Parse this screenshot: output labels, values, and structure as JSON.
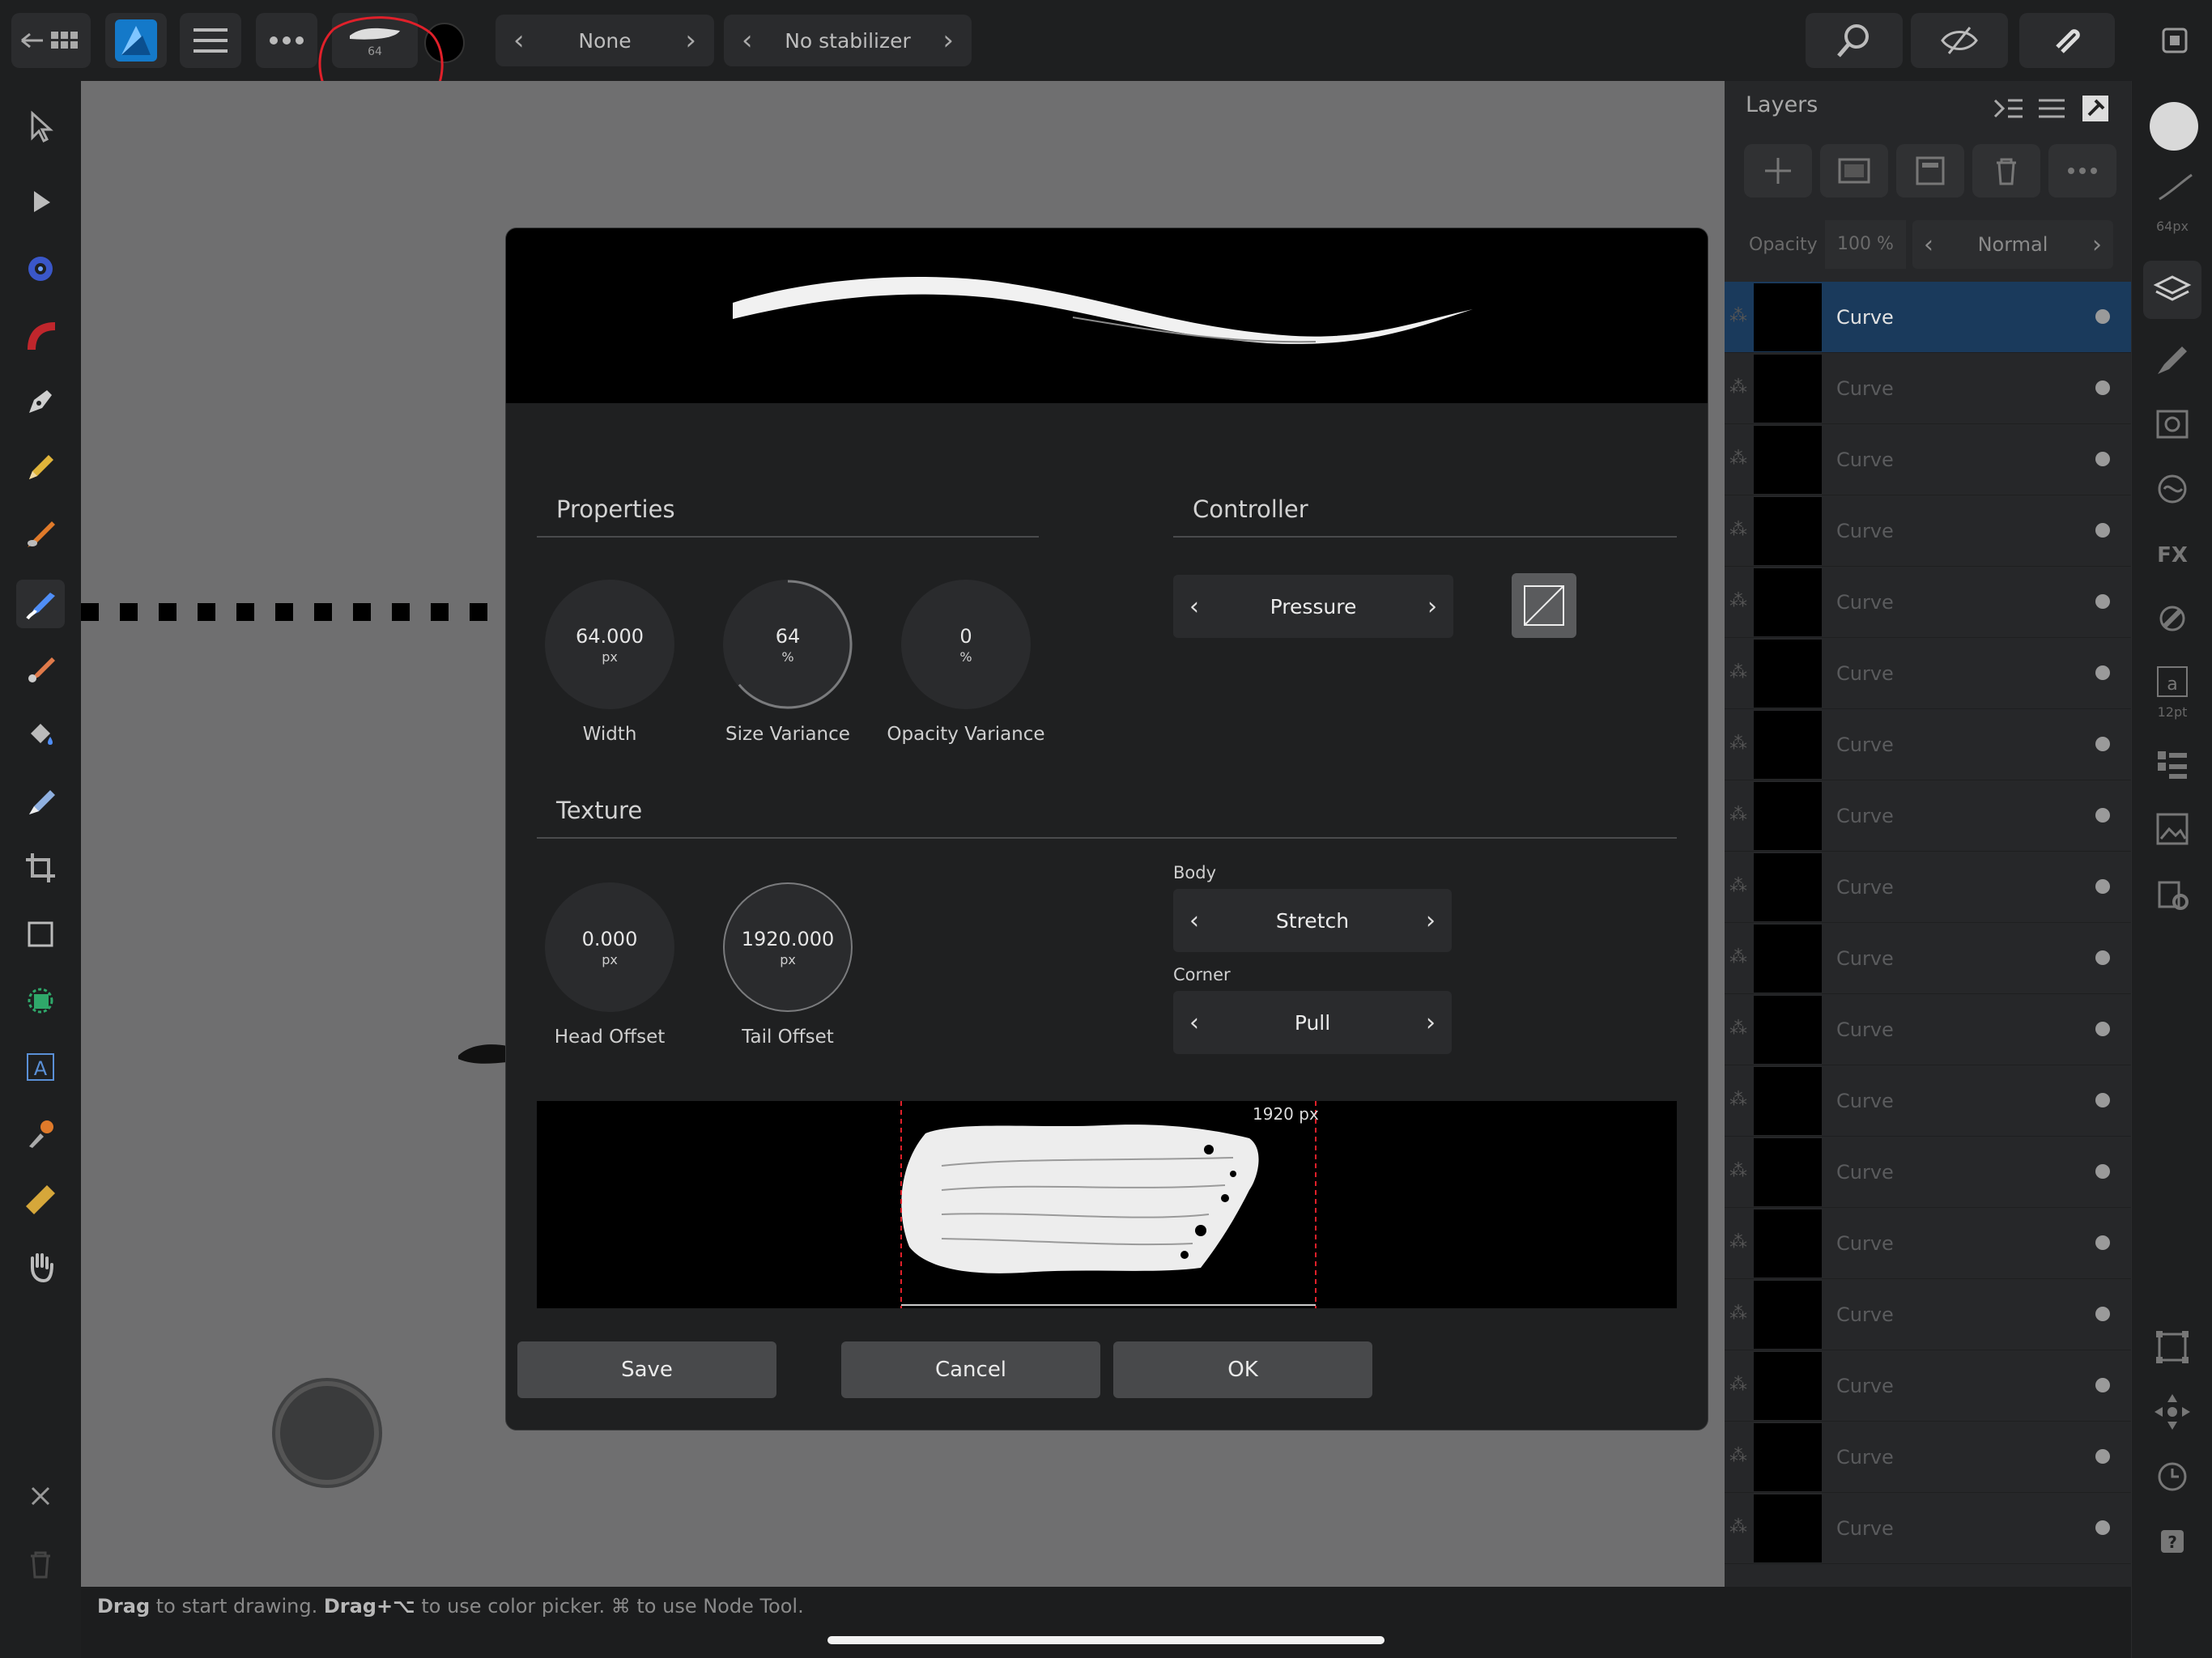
{
  "topbar": {
    "back_icon": "back-grid-icon",
    "app_logo": "affinity-designer-logo",
    "brush_size_badge": "64",
    "pressure_selector": {
      "value": "None"
    },
    "stabilizer_selector": {
      "value": "No stabilizer"
    }
  },
  "layers_panel": {
    "title": "Layers",
    "opacity_label": "Opacity",
    "opacity_value": "100 %",
    "blend_mode": "Normal",
    "layers": [
      {
        "name": "Curve",
        "selected": true
      },
      {
        "name": "Curve"
      },
      {
        "name": "Curve"
      },
      {
        "name": "Curve"
      },
      {
        "name": "Curve"
      },
      {
        "name": "Curve"
      },
      {
        "name": "Curve"
      },
      {
        "name": "Curve"
      },
      {
        "name": "Curve"
      },
      {
        "name": "Curve"
      },
      {
        "name": "Curve"
      },
      {
        "name": "Curve"
      },
      {
        "name": "Curve"
      },
      {
        "name": "Curve"
      },
      {
        "name": "Curve"
      },
      {
        "name": "Curve"
      },
      {
        "name": "Curve"
      },
      {
        "name": "Curve"
      }
    ]
  },
  "right_strip": {
    "brush_size_label": "64px",
    "text_size_label": "12pt"
  },
  "dialog": {
    "properties_title": "Properties",
    "controller_title": "Controller",
    "texture_title": "Texture",
    "width": {
      "value": "64.000",
      "unit": "px",
      "label": "Width"
    },
    "size_variance": {
      "value": "64",
      "unit": "%",
      "label": "Size Variance",
      "fraction": 0.64
    },
    "opacity_variance": {
      "value": "0",
      "unit": "%",
      "label": "Opacity Variance"
    },
    "controller_value": "Pressure",
    "head_offset": {
      "value": "0.000",
      "unit": "px",
      "label": "Head Offset"
    },
    "tail_offset": {
      "value": "1920.000",
      "unit": "px",
      "label": "Tail Offset"
    },
    "body_label": "Body",
    "body_value": "Stretch",
    "corner_label": "Corner",
    "corner_value": "Pull",
    "texture_width_label": "1920 px",
    "save_label": "Save",
    "cancel_label": "Cancel",
    "ok_label": "OK"
  },
  "statusbar": {
    "drag": "Drag",
    "text1": " to start drawing. ",
    "drag_alt": "Drag+⌥",
    "text2": " to use color picker. ⌘ to use Node Tool."
  },
  "colors": {
    "accent": "#1a3a5c",
    "annotation": "#e0202a"
  }
}
